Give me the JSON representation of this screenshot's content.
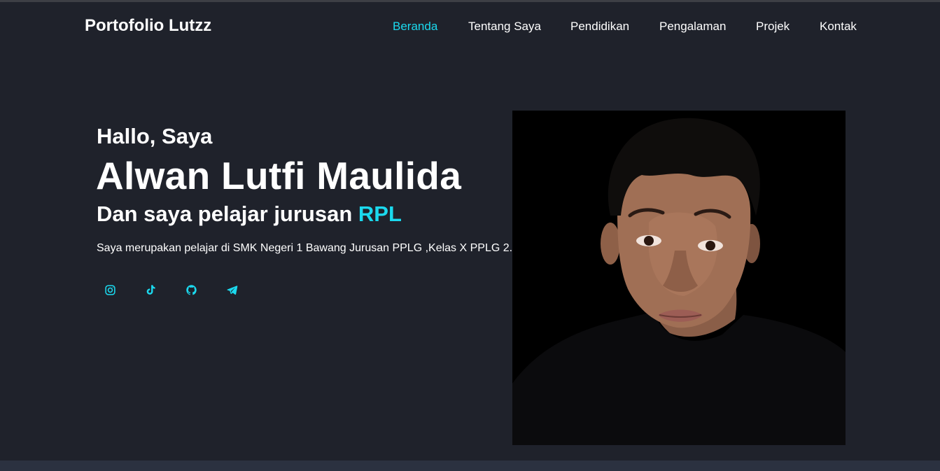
{
  "brand": "Portofolio Lutzz",
  "nav": [
    {
      "label": "Beranda",
      "active": true
    },
    {
      "label": "Tentang Saya",
      "active": false
    },
    {
      "label": "Pendidikan",
      "active": false
    },
    {
      "label": "Pengalaman",
      "active": false
    },
    {
      "label": "Projek",
      "active": false
    },
    {
      "label": "Kontak",
      "active": false
    }
  ],
  "hero": {
    "greeting": "Hallo, Saya",
    "name": "Alwan Lutfi Maulida",
    "tagline_prefix": "Dan saya pelajar jurusan ",
    "tagline_accent": "RPL",
    "description": "Saya merupakan pelajar di SMK Negeri 1 Bawang Jurusan PPLG ,Kelas X PPLG 2."
  },
  "socials": [
    {
      "icon": "instagram-icon"
    },
    {
      "icon": "tiktok-icon"
    },
    {
      "icon": "github-icon"
    },
    {
      "icon": "telegram-icon"
    }
  ],
  "colors": {
    "background": "#1f222b",
    "accent": "#1bd9ee",
    "text": "#ffffff",
    "footer_band": "#2b3140"
  }
}
